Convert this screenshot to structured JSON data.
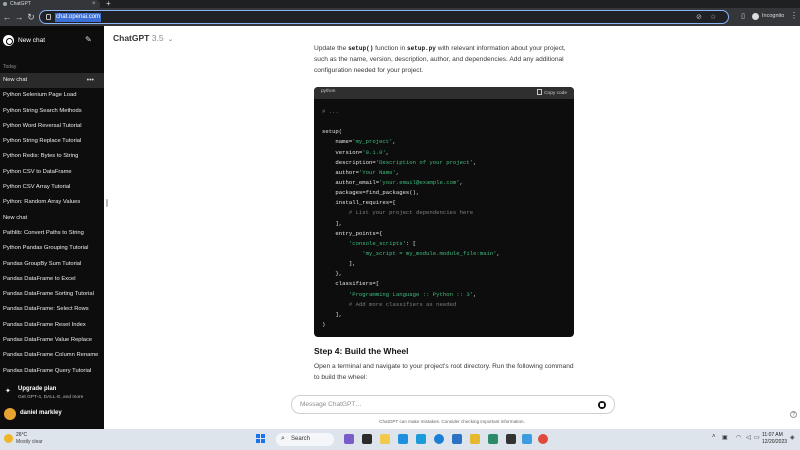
{
  "browser": {
    "tab_title": "ChatGPT",
    "url": "chat.openai.com",
    "profile_label": "Incognito"
  },
  "sidebar": {
    "new_chat_label": "New chat",
    "section_today": "Today",
    "items": [
      {
        "label": "New chat",
        "active": true
      },
      {
        "label": "Python Selenium Page Load"
      },
      {
        "label": "Python String Search Methods"
      },
      {
        "label": "Python Word Reversal Tutorial"
      },
      {
        "label": "Python String Replace Tutorial"
      },
      {
        "label": "Python Redis: Bytes to String"
      },
      {
        "label": "Python CSV to DataFrame"
      },
      {
        "label": "Python CSV Array Tutorial"
      },
      {
        "label": "Python: Random Array Values"
      },
      {
        "label": "New chat"
      },
      {
        "label": "Pathlib: Convert Paths to String"
      },
      {
        "label": "Python Pandas Grouping Tutorial"
      },
      {
        "label": "Pandas GroupBy Sum Tutorial"
      },
      {
        "label": "Pandas DataFrame to Excel"
      },
      {
        "label": "Pandas DataFrame Sorting Tutorial"
      },
      {
        "label": "Pandas DataFrame: Select Rows"
      },
      {
        "label": "Pandas DataFrame Reset Index"
      },
      {
        "label": "Pandas DataFrame Value Replace"
      },
      {
        "label": "Pandas DataFrame Column Rename"
      },
      {
        "label": "Pandas DataFrame Query Tutorial"
      }
    ],
    "upgrade_title": "Upgrade plan",
    "upgrade_subtitle": "Get GPT-4, DALL·E, and more",
    "user_name": "daniel markley"
  },
  "main": {
    "model_name": "ChatGPT",
    "model_version": "3.5",
    "para1_pre": "Update the ",
    "para1_code1": "setup()",
    "para1_mid": " function in ",
    "para1_code2": "setup.py",
    "para1_post": " with relevant information about your project, such as the name, version, description, author, and dependencies. Add any additional configuration needed for your project.",
    "code_lang": "python",
    "copy_label": "Copy code",
    "code_lines": [
      [
        {
          "t": "# ...",
          "c": "com"
        }
      ],
      [
        {
          "t": "",
          "c": "pl"
        }
      ],
      [
        {
          "t": "setup(",
          "c": "pl"
        }
      ],
      [
        {
          "t": "    name=",
          "c": "pl"
        },
        {
          "t": "'my_project'",
          "c": "str"
        },
        {
          "t": ",",
          "c": "pl"
        }
      ],
      [
        {
          "t": "    version=",
          "c": "pl"
        },
        {
          "t": "'0.1.0'",
          "c": "str"
        },
        {
          "t": ",",
          "c": "pl"
        }
      ],
      [
        {
          "t": "    description=",
          "c": "pl"
        },
        {
          "t": "'Description of your project'",
          "c": "str"
        },
        {
          "t": ",",
          "c": "pl"
        }
      ],
      [
        {
          "t": "    author=",
          "c": "pl"
        },
        {
          "t": "'Your Name'",
          "c": "str"
        },
        {
          "t": ",",
          "c": "pl"
        }
      ],
      [
        {
          "t": "    author_email=",
          "c": "pl"
        },
        {
          "t": "'your.email@example.com'",
          "c": "str"
        },
        {
          "t": ",",
          "c": "pl"
        }
      ],
      [
        {
          "t": "    packages=find_packages(),",
          "c": "pl"
        }
      ],
      [
        {
          "t": "    install_requires=[",
          "c": "pl"
        }
      ],
      [
        {
          "t": "        # List your project dependencies here",
          "c": "com"
        }
      ],
      [
        {
          "t": "    ],",
          "c": "pl"
        }
      ],
      [
        {
          "t": "    entry_points={",
          "c": "pl"
        }
      ],
      [
        {
          "t": "        ",
          "c": "pl"
        },
        {
          "t": "'console_scripts'",
          "c": "str"
        },
        {
          "t": ": [",
          "c": "pl"
        }
      ],
      [
        {
          "t": "            ",
          "c": "pl"
        },
        {
          "t": "'my_script = my_module.module_file:main'",
          "c": "str"
        },
        {
          "t": ",",
          "c": "pl"
        }
      ],
      [
        {
          "t": "        ],",
          "c": "pl"
        }
      ],
      [
        {
          "t": "    },",
          "c": "pl"
        }
      ],
      [
        {
          "t": "    classifiers=[",
          "c": "pl"
        }
      ],
      [
        {
          "t": "        ",
          "c": "pl"
        },
        {
          "t": "'Programming Language :: Python :: 3'",
          "c": "str"
        },
        {
          "t": ",",
          "c": "pl"
        }
      ],
      [
        {
          "t": "        # Add more classifiers as needed",
          "c": "com"
        }
      ],
      [
        {
          "t": "    ],",
          "c": "pl"
        }
      ],
      [
        {
          "t": ")",
          "c": "pl"
        }
      ]
    ],
    "step_heading": "Step 4: Build the Wheel",
    "para2": "Open a terminal and navigate to your project's root directory. Run the following command to build the wheel:",
    "input_placeholder": "Message ChatGPT…",
    "disclaimer": "ChatGPT can make mistakes. Consider checking important information.",
    "help_label": "?"
  },
  "taskbar": {
    "temperature": "26°C",
    "weather": "Mostly clear",
    "search_label": "Search",
    "time": "11:07 AM",
    "date": "12/20/2023"
  },
  "colors": {
    "sidebar_bg": "#0d0d0d",
    "code_string": "#3dbb7e",
    "code_comment": "#7f7f7f",
    "omnibox_focus": "#8ab4f8"
  }
}
